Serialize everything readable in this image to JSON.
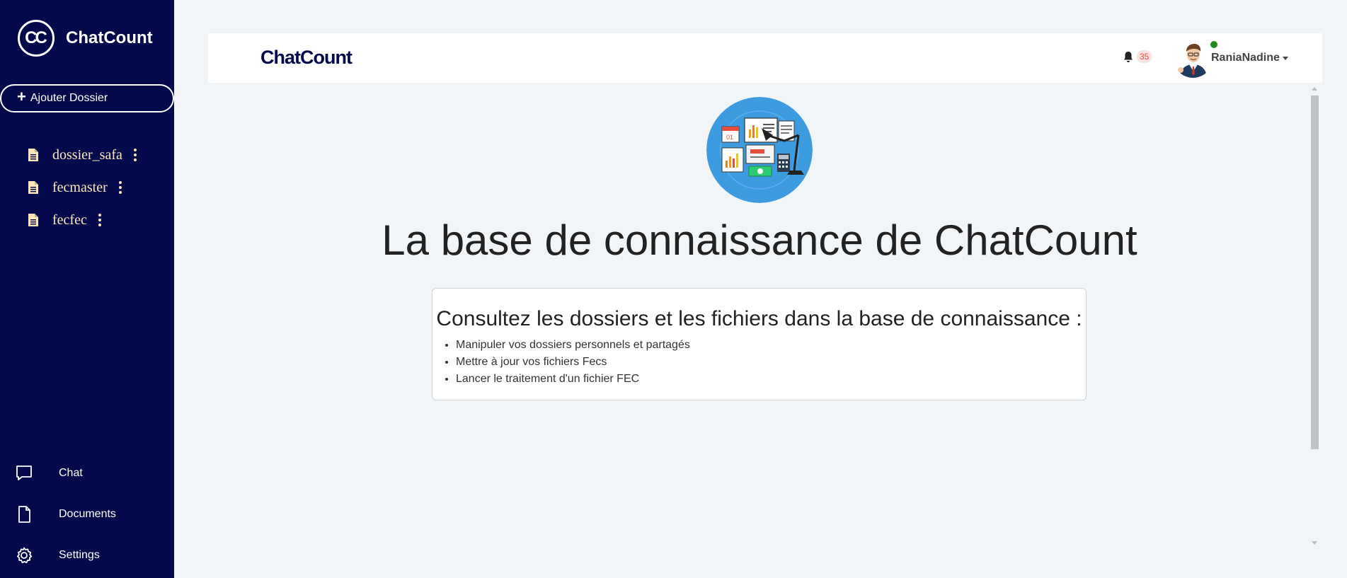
{
  "sidebar": {
    "brand_initials": "CC",
    "brand_name": "ChatCount",
    "add_button_label": "Ajouter Dossier",
    "folders": [
      {
        "name": "dossier_safa",
        "icon": "file-icon"
      },
      {
        "name": "fecmaster",
        "icon": "file-icon"
      },
      {
        "name": "fecfec",
        "icon": "file-icon"
      }
    ],
    "nav": [
      {
        "label": "Chat",
        "icon": "chat-bubble-icon"
      },
      {
        "label": "Documents",
        "icon": "document-icon"
      },
      {
        "label": "Settings",
        "icon": "gear-icon"
      }
    ]
  },
  "header": {
    "logo_text": "ChatCount",
    "notification_count": "35",
    "username": "RaniaNadine",
    "status": "online"
  },
  "main": {
    "title": "La base de connaissance de ChatCount",
    "card": {
      "heading": "Consultez les dossiers et les fichiers dans la base de connaissance :",
      "items": [
        "Manipuler vos dossiers personnels et partagés",
        "Mettre à jour vos fichiers Fecs",
        "Lancer le traitement d'un fichier FEC"
      ]
    }
  },
  "colors": {
    "sidebar_bg": "#03094a",
    "folder_text": "#fde7b8",
    "page_bg": "#f2f5f8",
    "badge_bg": "#fde4e4",
    "badge_text": "#e34b4b",
    "online": "#1f8a1f",
    "hero_circle": "#3d9be0"
  }
}
